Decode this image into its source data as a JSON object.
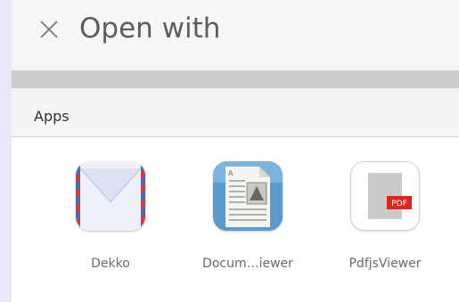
{
  "dialog": {
    "title": "Open with",
    "close_icon": "close-icon"
  },
  "section": {
    "label": "Apps"
  },
  "apps": [
    {
      "label": "Dekko",
      "icon": "dekko-mail-icon"
    },
    {
      "label": "Docum…iewer",
      "icon": "document-viewer-icon"
    },
    {
      "label": "PdfjsViewer",
      "icon": "pdf-viewer-icon",
      "badge": "PDF"
    }
  ],
  "colors": {
    "pdf_badge": "#e2231a",
    "doc_icon_bg": "#5a9bcc"
  }
}
